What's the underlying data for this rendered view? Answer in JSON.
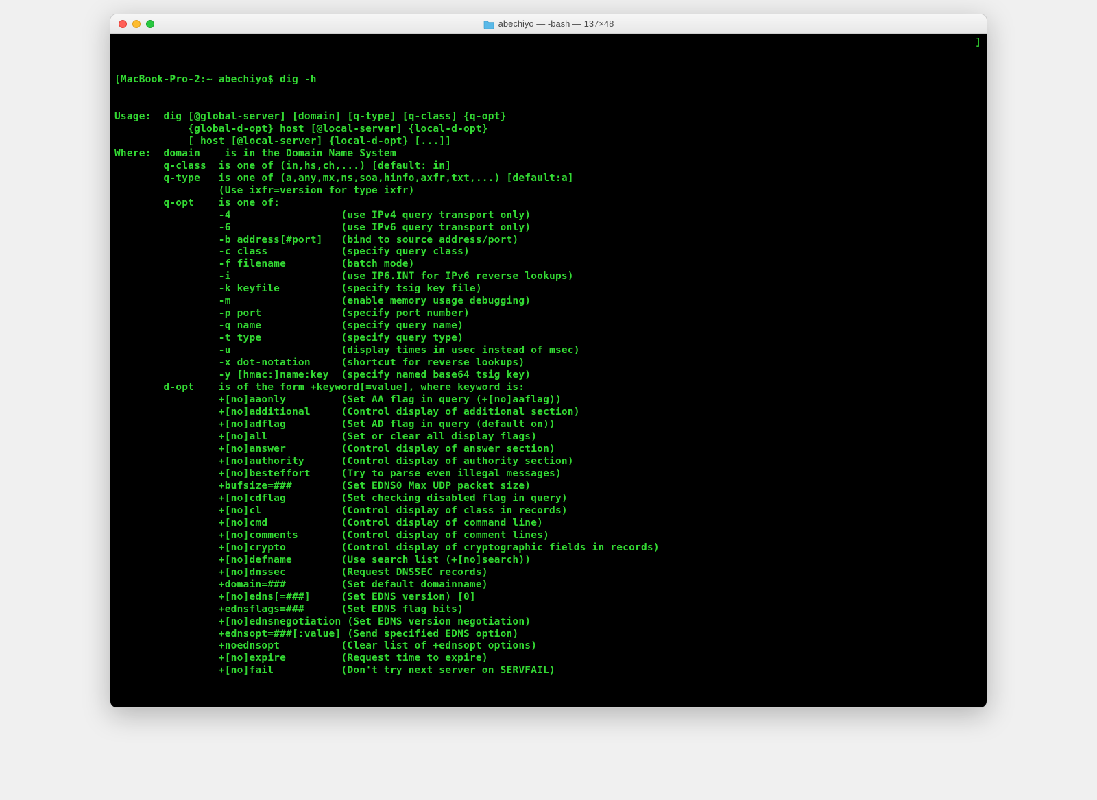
{
  "window": {
    "title": "abechiyo — -bash — 137×48"
  },
  "prompt": {
    "host": "[MacBook-Pro-2:~ abechiyo$ ",
    "command": "dig -h"
  },
  "corner": "]",
  "lines": [
    "Usage:  dig [@global-server] [domain] [q-type] [q-class] {q-opt}",
    "            {global-d-opt} host [@local-server] {local-d-opt}",
    "            [ host [@local-server] {local-d-opt} [...]]",
    "Where:  domain    is in the Domain Name System",
    "        q-class  is one of (in,hs,ch,...) [default: in]",
    "        q-type   is one of (a,any,mx,ns,soa,hinfo,axfr,txt,...) [default:a]",
    "                 (Use ixfr=version for type ixfr)",
    "        q-opt    is one of:",
    "                 -4                  (use IPv4 query transport only)",
    "                 -6                  (use IPv6 query transport only)",
    "                 -b address[#port]   (bind to source address/port)",
    "                 -c class            (specify query class)",
    "                 -f filename         (batch mode)",
    "                 -i                  (use IP6.INT for IPv6 reverse lookups)",
    "                 -k keyfile          (specify tsig key file)",
    "                 -m                  (enable memory usage debugging)",
    "                 -p port             (specify port number)",
    "                 -q name             (specify query name)",
    "                 -t type             (specify query type)",
    "                 -u                  (display times in usec instead of msec)",
    "                 -x dot-notation     (shortcut for reverse lookups)",
    "                 -y [hmac:]name:key  (specify named base64 tsig key)",
    "        d-opt    is of the form +keyword[=value], where keyword is:",
    "                 +[no]aaonly         (Set AA flag in query (+[no]aaflag))",
    "                 +[no]additional     (Control display of additional section)",
    "                 +[no]adflag         (Set AD flag in query (default on))",
    "                 +[no]all            (Set or clear all display flags)",
    "                 +[no]answer         (Control display of answer section)",
    "                 +[no]authority      (Control display of authority section)",
    "                 +[no]besteffort     (Try to parse even illegal messages)",
    "                 +bufsize=###        (Set EDNS0 Max UDP packet size)",
    "                 +[no]cdflag         (Set checking disabled flag in query)",
    "                 +[no]cl             (Control display of class in records)",
    "                 +[no]cmd            (Control display of command line)",
    "                 +[no]comments       (Control display of comment lines)",
    "                 +[no]crypto         (Control display of cryptographic fields in records)",
    "                 +[no]defname        (Use search list (+[no]search))",
    "                 +[no]dnssec         (Request DNSSEC records)",
    "                 +domain=###         (Set default domainname)",
    "                 +[no]edns[=###]     (Set EDNS version) [0]",
    "                 +ednsflags=###      (Set EDNS flag bits)",
    "                 +[no]ednsnegotiation (Set EDNS version negotiation)",
    "                 +ednsopt=###[:value] (Send specified EDNS option)",
    "                 +noednsopt          (Clear list of +ednsopt options)",
    "                 +[no]expire         (Request time to expire)",
    "                 +[no]fail           (Don't try next server on SERVFAIL)"
  ]
}
